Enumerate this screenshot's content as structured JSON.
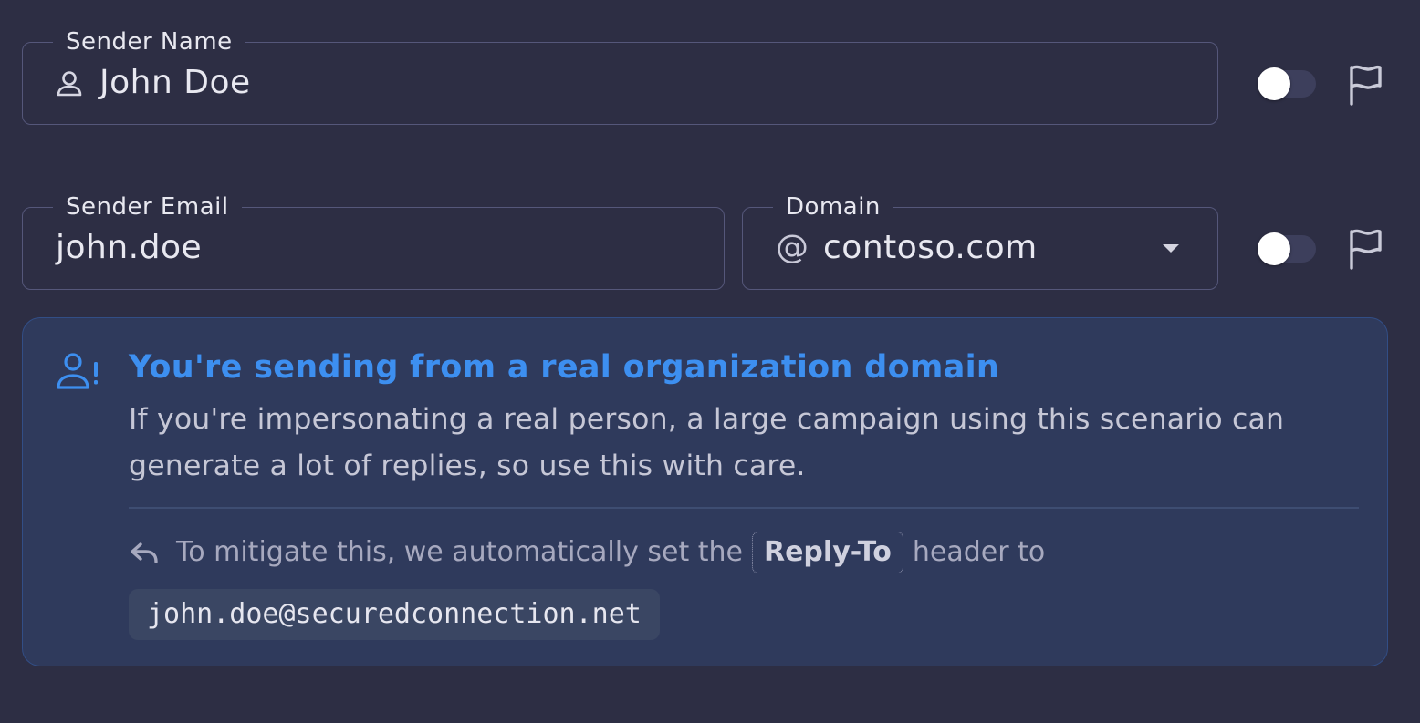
{
  "sender_name": {
    "label": "Sender Name",
    "value": "John Doe",
    "icon": "person-icon",
    "toggle_on": false,
    "flag_icon": "flag-icon"
  },
  "sender_email": {
    "label": "Sender Email",
    "value": "john.doe",
    "toggle_on": false,
    "flag_icon": "flag-icon"
  },
  "domain": {
    "label": "Domain",
    "at_symbol": "@",
    "value": "contoso.com",
    "icon": "chevron-down-icon"
  },
  "alert": {
    "icon": "person-warning-icon",
    "title": "You're sending from a real organization domain",
    "body": "If you're impersonating a real person, a large campaign using this scenario can generate a lot of replies, so use this with care.",
    "reply_icon": "reply-icon",
    "reply_prefix": "To mitigate this, we automatically set the",
    "reply_code": "Reply-To",
    "reply_suffix": "header to",
    "reply_email": "john.doe@securedconnection.net"
  },
  "colors": {
    "background": "#2d2e44",
    "accent": "#3d8ff0",
    "alert_background": "#2f3a5c",
    "alert_border": "#324e86"
  }
}
